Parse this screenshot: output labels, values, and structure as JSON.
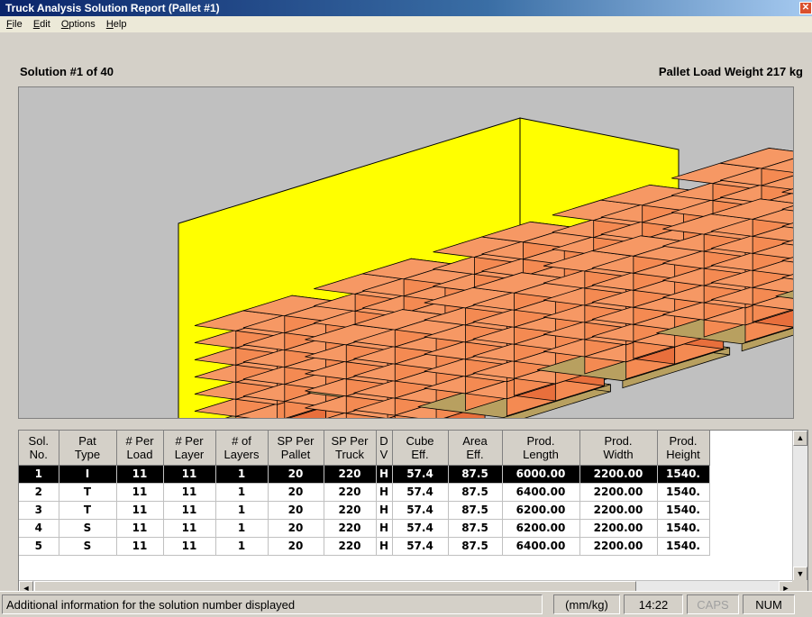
{
  "window": {
    "title": "Truck Analysis Solution Report (Pallet #1)",
    "close_glyph": "✕"
  },
  "menu": [
    {
      "accel": "F",
      "rest": "ile"
    },
    {
      "accel": "E",
      "rest": "dit"
    },
    {
      "accel": "O",
      "rest": "ptions"
    },
    {
      "accel": "H",
      "rest": "elp"
    }
  ],
  "header": {
    "solution_label": "Solution #1 of 40",
    "weight_label": "Pallet Load Weight 217 kg"
  },
  "colors": {
    "truck_wall": "#ffff00",
    "carton_front": "#f48a52",
    "carton_side": "#e86f3c",
    "carton_top": "#f69864",
    "pallet": "#b8a060",
    "background": "#c0c0c0",
    "selected_row": "#000000"
  },
  "table": {
    "columns": [
      [
        "Sol.",
        "No."
      ],
      [
        "Pat",
        "Type"
      ],
      [
        "# Per",
        "Load"
      ],
      [
        "# Per",
        "Layer"
      ],
      [
        "# of",
        "Layers"
      ],
      [
        "SP Per",
        "Pallet"
      ],
      [
        "SP Per",
        "Truck"
      ],
      [
        "D",
        "V"
      ],
      [
        "Cube",
        "Eff."
      ],
      [
        "Area",
        "Eff."
      ],
      [
        "Prod.",
        "Length"
      ],
      [
        "Prod.",
        "Width"
      ],
      [
        "Prod.",
        "Height"
      ]
    ],
    "rows": [
      [
        "1",
        "I",
        "11",
        "11",
        "1",
        "20",
        "220",
        "H",
        "57.4",
        "87.5",
        "6000.00",
        "2200.00",
        "1540."
      ],
      [
        "2",
        "T",
        "11",
        "11",
        "1",
        "20",
        "220",
        "H",
        "57.4",
        "87.5",
        "6400.00",
        "2200.00",
        "1540."
      ],
      [
        "3",
        "T",
        "11",
        "11",
        "1",
        "20",
        "220",
        "H",
        "57.4",
        "87.5",
        "6200.00",
        "2200.00",
        "1540."
      ],
      [
        "4",
        "S",
        "11",
        "11",
        "1",
        "20",
        "220",
        "H",
        "57.4",
        "87.5",
        "6200.00",
        "2200.00",
        "1540."
      ],
      [
        "5",
        "S",
        "11",
        "11",
        "1",
        "20",
        "220",
        "H",
        "57.4",
        "87.5",
        "6400.00",
        "2200.00",
        "1540."
      ]
    ],
    "selected_row": 0,
    "scroll_up_glyph": "▲",
    "scroll_down_glyph": "▼",
    "scroll_left_glyph": "◄",
    "scroll_right_glyph": "►"
  },
  "status": {
    "message": "Additional information for the solution number displayed",
    "units": "(mm/kg)",
    "time": "14:22",
    "caps": "CAPS",
    "num": "NUM"
  }
}
